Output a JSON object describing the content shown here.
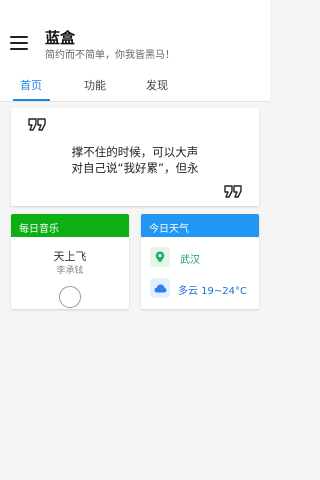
{
  "header": {
    "title": "蓝盒",
    "subtitle": "简约而不简单，你我皆黑马！"
  },
  "tabs": [
    {
      "label": "首页",
      "active": true
    },
    {
      "label": "功能",
      "active": false
    },
    {
      "label": "发现",
      "active": false
    }
  ],
  "quote": {
    "line1": "撑不住的时候，可以大声",
    "line2": "对自己说“我好累”，但永"
  },
  "music": {
    "header": "每日音乐",
    "song": "天上飞",
    "artist": "李承铉"
  },
  "weather": {
    "header": "今日天气",
    "city": "武汉",
    "condition": "多云 19~24°C"
  },
  "colors": {
    "accent": "#1e88e5",
    "music_header": "#0eaf12",
    "weather_header": "#2196f3"
  },
  "icons": [
    "menu-icon",
    "quote-open-icon",
    "quote-close-icon",
    "play-icon",
    "location-pin-icon",
    "cloud-icon"
  ]
}
